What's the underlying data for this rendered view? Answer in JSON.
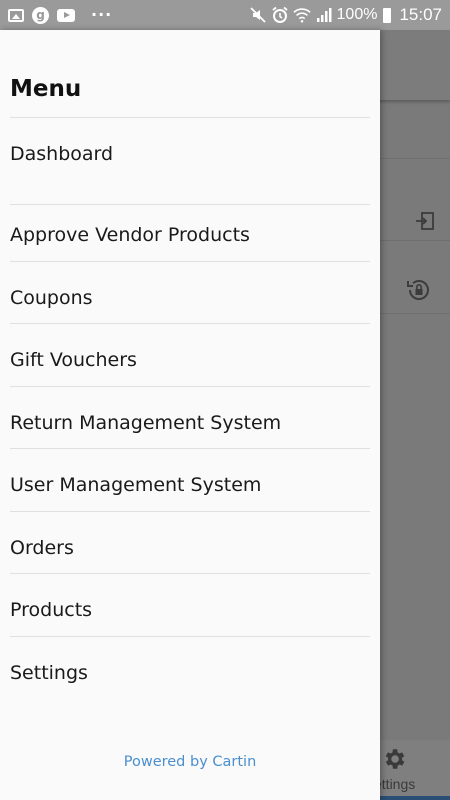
{
  "status_bar": {
    "left_icons": [
      "gallery-icon",
      "google-icon",
      "youtube-icon"
    ],
    "google_glyph": "g",
    "overflow": "···",
    "right_icons": [
      "mute-icon",
      "alarm-icon",
      "wifi-icon",
      "signal-icon"
    ],
    "battery_percent": "100%",
    "time": "15:07"
  },
  "drawer": {
    "title": "Menu",
    "items": [
      {
        "label": "Dashboard"
      },
      {
        "label": "Approve Vendor Products"
      },
      {
        "label": "Coupons"
      },
      {
        "label": "Gift Vouchers"
      },
      {
        "label": "Return Management System"
      },
      {
        "label": "User Management System"
      },
      {
        "label": "Orders"
      },
      {
        "label": "Products"
      },
      {
        "label": "Settings"
      }
    ],
    "footer": "Powered by Cartin"
  },
  "background": {
    "icons": [
      "login-icon",
      "restore-lock-icon",
      "gear-icon"
    ],
    "bottom_nav_label": "ettings"
  },
  "colors": {
    "drawer_bg": "#fafafa",
    "status_bar_bg": "#9a9a9a",
    "footer_link": "#4a8fcf",
    "scrim": "#7a7a7a"
  }
}
